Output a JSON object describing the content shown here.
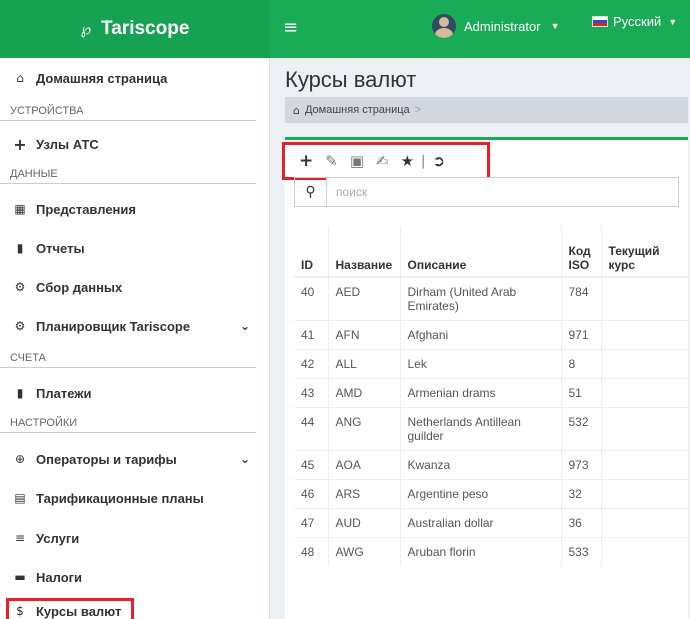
{
  "header": {
    "brand": "Tariscope",
    "user": "Administrator",
    "language": "Русский"
  },
  "sidebar": {
    "home": "Домашняя страница",
    "sections": [
      "УСТРОЙСТВА",
      "ДАННЫЕ",
      "СЧЕТА",
      "НАСТРОЙКИ"
    ],
    "items": [
      {
        "label": "Узлы АТС",
        "icon": "plus-icon"
      },
      {
        "label": "Представления",
        "icon": "table-icon"
      },
      {
        "label": "Отчеты",
        "icon": "file-icon"
      },
      {
        "label": "Сбор данных",
        "icon": "cogs-icon"
      },
      {
        "label": "Планировщик Tariscope",
        "icon": "scheduler-icon"
      },
      {
        "label": "Платежи",
        "icon": "payments-icon"
      },
      {
        "label": "Операторы и тарифы",
        "icon": "globe-icon"
      },
      {
        "label": "Тарификационные планы",
        "icon": "list-alt-icon"
      },
      {
        "label": "Услуги",
        "icon": "list-icon"
      },
      {
        "label": "Налоги",
        "icon": "money-icon"
      },
      {
        "label": "Курсы валют",
        "icon": "dollar-icon"
      }
    ]
  },
  "page": {
    "title": "Курсы валют",
    "breadcrumb": "Домашняя страница",
    "breadcrumb_sep": ">"
  },
  "search": {
    "placeholder": "поиск"
  },
  "table": {
    "headers": [
      "ID",
      "Название",
      "Описание",
      "Код ISO",
      "Текущий курс"
    ],
    "rows": [
      [
        "40",
        "AED",
        "Dirham (United Arab Emirates)",
        "784",
        ""
      ],
      [
        "41",
        "AFN",
        "Afghani",
        "971",
        ""
      ],
      [
        "42",
        "ALL",
        "Lek",
        "8",
        ""
      ],
      [
        "43",
        "AMD",
        "Armenian drams",
        "51",
        ""
      ],
      [
        "44",
        "ANG",
        "Netherlands Antillean guilder",
        "532",
        ""
      ],
      [
        "45",
        "AOA",
        "Kwanza",
        "973",
        ""
      ],
      [
        "46",
        "ARS",
        "Argentine peso",
        "32",
        ""
      ],
      [
        "47",
        "AUD",
        "Australian dollar",
        "36",
        ""
      ],
      [
        "48",
        "AWG",
        "Aruban florin",
        "533",
        ""
      ]
    ]
  },
  "colors": {
    "brand_green": "#1aab57",
    "highlight_red": "#e8202a"
  }
}
